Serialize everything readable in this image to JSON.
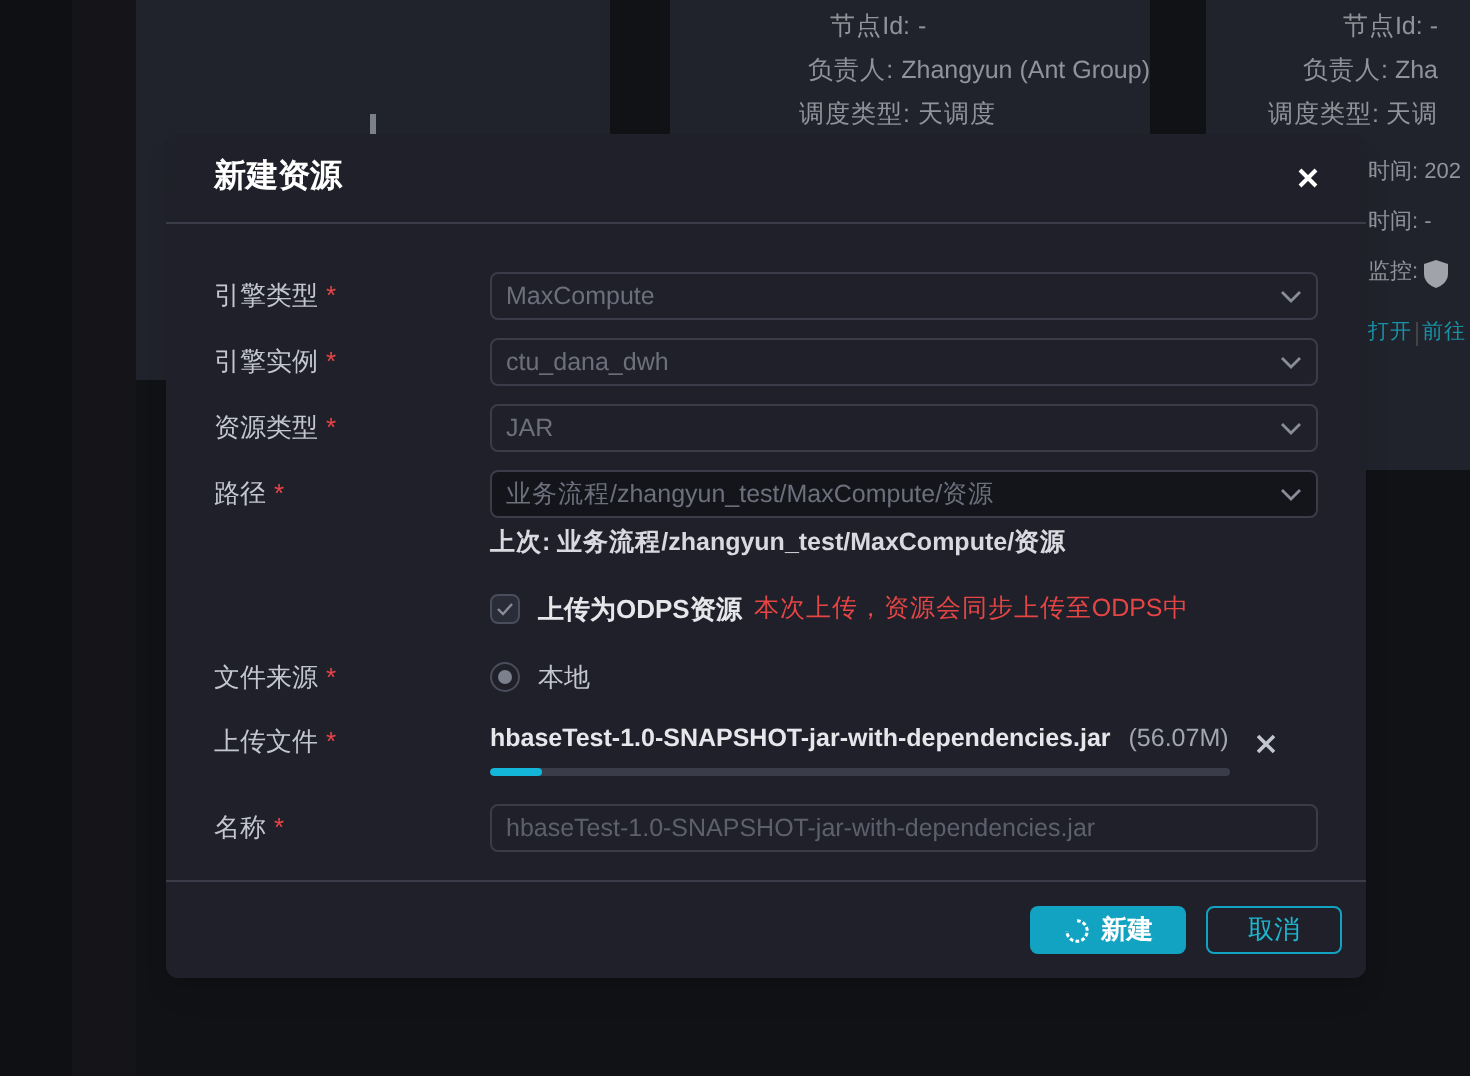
{
  "background": {
    "middle_card": {
      "rows": [
        {
          "label": "节点Id:",
          "value": "-"
        },
        {
          "label": "负责人:",
          "value": "Zhangyun (Ant Group)"
        },
        {
          "label": "调度类型:",
          "value": "天调度"
        }
      ]
    },
    "right_card": {
      "rows": [
        "节点Id: -",
        "负责人: Zha",
        "调度类型: 天调"
      ],
      "lower_rows": [
        {
          "text": "时间: 202",
          "kind": "text"
        },
        {
          "text": "时间: -",
          "kind": "text"
        },
        {
          "text": "监控:",
          "kind": "shield"
        }
      ],
      "links": [
        "打开",
        "前往"
      ]
    }
  },
  "dialog": {
    "title": "新建资源",
    "fields": [
      {
        "kind": "select",
        "label": "引擎类型",
        "required": "*",
        "value": "MaxCompute",
        "disabled": true
      },
      {
        "kind": "select",
        "label": "引擎实例",
        "required": "*",
        "value": "ctu_dana_dwh",
        "disabled": true
      },
      {
        "kind": "select",
        "label": "资源类型",
        "required": "*",
        "value": "JAR",
        "disabled": true
      },
      {
        "kind": "select",
        "label": "路径",
        "required": "*",
        "value": "业务流程/zhangyun_test/MaxCompute/资源",
        "disabled": false,
        "hint": "上次: 业务流程/zhangyun_test/MaxCompute/资源"
      },
      {
        "kind": "checkbox",
        "label": "上传为ODPS资源",
        "checked": true,
        "note": "本次上传，资源会同步上传至ODPS中"
      },
      {
        "kind": "radio",
        "label": "文件来源",
        "required": "*",
        "option": "本地",
        "selected": true
      },
      {
        "kind": "upload",
        "label": "上传文件",
        "required": "*",
        "file": "hbaseTest-1.0-SNAPSHOT-jar-with-dependencies.jar",
        "size": "(56.07M)",
        "level": 0.07
      },
      {
        "kind": "input",
        "label": "名称",
        "required": "*",
        "placeholder": "hbaseTest-1.0-SNAPSHOT-jar-with-dependencies.jar"
      }
    ],
    "buttons": [
      {
        "label": "新建",
        "kind": "primary",
        "loading": true
      },
      {
        "label": "取消",
        "kind": "secondary",
        "loading": false
      }
    ]
  }
}
